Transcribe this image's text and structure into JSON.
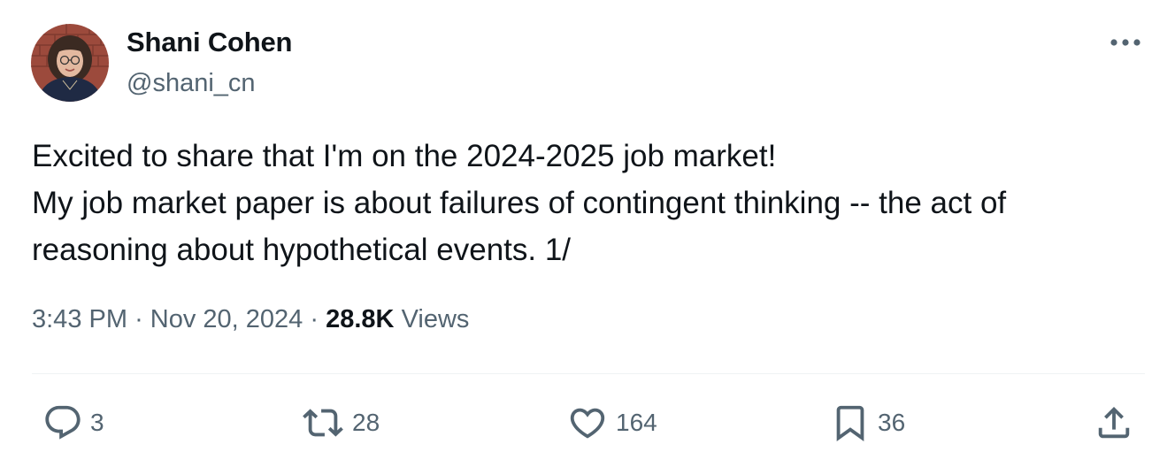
{
  "author": {
    "display_name": "Shani Cohen",
    "handle": "@shani_cn"
  },
  "tweet": {
    "lines": [
      "Excited to share that I'm on the 2024-2025 job market!",
      "My job market paper is about failures of contingent thinking -- the act of",
      "reasoning about hypothetical events. 1/"
    ],
    "time": "3:43 PM",
    "separator": "·",
    "date": "Nov 20, 2024",
    "views_count": "28.8K",
    "views_label": "Views"
  },
  "actions": {
    "replies": "3",
    "reposts": "28",
    "likes": "164",
    "bookmarks": "36"
  },
  "icons": {
    "more": "more-horizontal-icon",
    "reply": "reply-icon",
    "repost": "repost-icon",
    "like": "heart-icon",
    "bookmark": "bookmark-icon",
    "share": "share-icon"
  },
  "colors": {
    "text_primary": "#0f1419",
    "text_secondary": "#536471",
    "divider": "#eff3f4"
  }
}
